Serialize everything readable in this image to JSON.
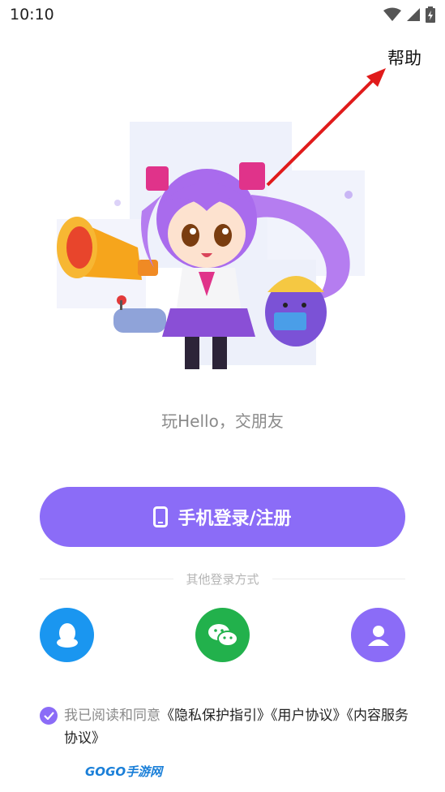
{
  "status_bar": {
    "time": "10:10"
  },
  "header": {
    "help_label": "帮助"
  },
  "tagline": "玩Hello，交朋友",
  "login": {
    "phone_button_label": "手机登录/注册"
  },
  "other_login": {
    "divider_text": "其他登录方式",
    "options": [
      "qq",
      "wechat",
      "account"
    ]
  },
  "agreement": {
    "prefix": "我已阅读和同意",
    "links": [
      "《隐私保护指引》",
      "《用户协议》",
      "《内容服务协议》"
    ],
    "checked": true
  },
  "watermark": {
    "text": "GOGO手游网"
  },
  "colors": {
    "primary": "#8b6cf7",
    "qq": "#1a96f0",
    "wechat": "#22b14c",
    "annotation_arrow": "#e01b1b"
  }
}
